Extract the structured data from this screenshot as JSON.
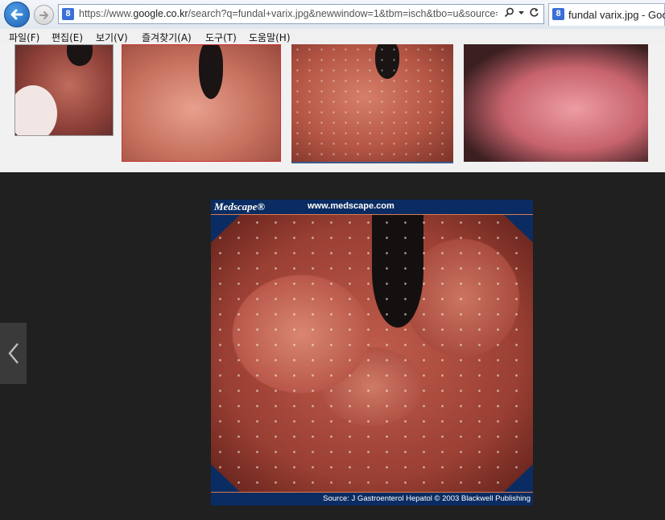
{
  "browser": {
    "url_prefix": "https://www.",
    "url_host": "google.co.kr",
    "url_rest": "/search?q=fundal+varix.jpg&newwindow=1&tbm=isch&tbo=u&source=",
    "tab_title": "fundal varix.jpg - Goo",
    "search_favicon_letter": "8",
    "icons": {
      "back": "back-arrow-icon",
      "forward": "forward-arrow-icon",
      "search": "search-icon",
      "dropdown": "chevron-down-icon",
      "refresh": "refresh-icon"
    }
  },
  "menu": {
    "items": [
      "파일(F)",
      "편집(E)",
      "보기(V)",
      "즐겨찾기(A)",
      "도구(T)",
      "도움말(H)"
    ]
  },
  "preview": {
    "brand": "Medscape®",
    "site": "www.medscape.com",
    "source": "Source: J Gastroenterol Hepatol © 2003 Blackwell Publishing",
    "prev_icon": "chevron-left-icon"
  }
}
